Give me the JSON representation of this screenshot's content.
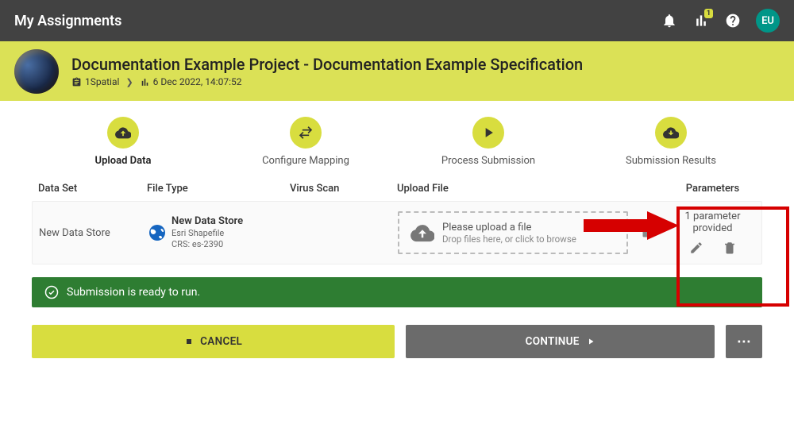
{
  "topbar": {
    "title": "My Assignments",
    "bell": "bell-icon",
    "stats": "stats-icon",
    "stats_badge": "1",
    "help": "help-icon",
    "avatar": "EU"
  },
  "project": {
    "title": "Documentation Example Project - Documentation Example Specification",
    "breadcrumb": {
      "org": "1Spatial",
      "date": "6 Dec 2022, 14:07:52"
    }
  },
  "stepper": [
    {
      "label": "Upload Data",
      "active": true
    },
    {
      "label": "Configure Mapping",
      "active": false
    },
    {
      "label": "Process Submission",
      "active": false
    },
    {
      "label": "Submission Results",
      "active": false
    }
  ],
  "table": {
    "headers": {
      "dataset": "Data Set",
      "filetype": "File Type",
      "virusscan": "Virus Scan",
      "uploadfile": "Upload File",
      "parameters": "Parameters"
    },
    "rows": [
      {
        "dataset": "New Data Store",
        "filetype_name": "New Data Store",
        "filetype_sub1": "Esri Shapefile",
        "filetype_sub2": "CRS: es-2390",
        "upload_main": "Please upload a file",
        "upload_sub": "Drop files here, or click to browse",
        "params_count": "1 parameter provided"
      }
    ]
  },
  "status": {
    "message": "Submission is ready to run."
  },
  "buttons": {
    "cancel": "CANCEL",
    "continue": "CONTINUE",
    "more": "⋯"
  }
}
